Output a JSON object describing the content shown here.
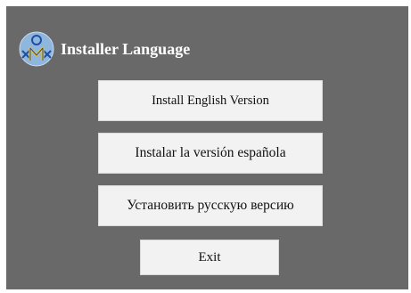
{
  "window": {
    "title": "Installer Language",
    "background_color": "#696969"
  },
  "logo": {
    "icon": "installer-mascot-logo",
    "colors": {
      "circle": "#8fb6dd",
      "figure": "#1f4fa3",
      "accent": "#f2c230"
    }
  },
  "buttons": {
    "english": "Install English Version",
    "spanish": "Instalar la versión española",
    "russian": "Установить русскую версию",
    "exit": "Exit"
  }
}
